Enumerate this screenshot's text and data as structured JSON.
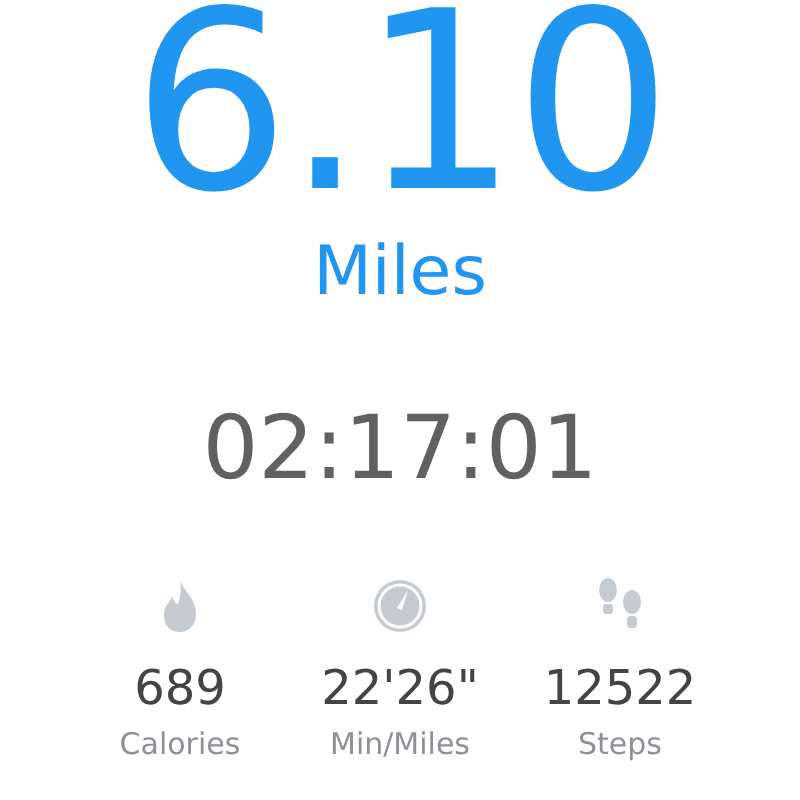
{
  "distance": {
    "value": "6.10",
    "unit": "Miles"
  },
  "duration": "02:17:01",
  "stats": [
    {
      "kind": "calories",
      "value": "689",
      "label": "Calories"
    },
    {
      "kind": "pace",
      "value": "22'26\"",
      "label": "Min/Miles"
    },
    {
      "kind": "steps",
      "value": "12522",
      "label": "Steps"
    }
  ]
}
